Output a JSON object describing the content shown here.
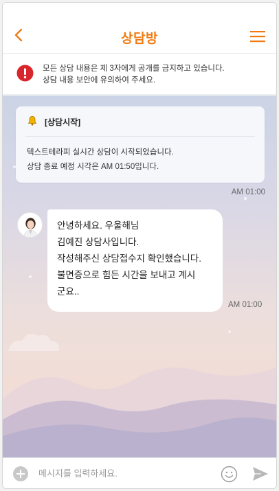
{
  "header": {
    "title": "상담방",
    "back_icon": "chevron-left-icon",
    "menu_icon": "hamburger-menu-icon"
  },
  "notice": {
    "icon": "alert-icon",
    "line1": "모든 상담 내용은 제 3자에게 공개를 금지하고 있습니다.",
    "line2": "상담 내용 보안에 유의하여 주세요."
  },
  "system_message": {
    "icon": "bell-icon",
    "title": "[상담시작]",
    "line1": "텍스트테라피 실시간 상담이 시작되었습니다.",
    "line2": "상담 종료 예정 시각은 AM 01:50입니다.",
    "time": "AM 01:00"
  },
  "counselor_message": {
    "avatar": "counselor-avatar",
    "text": "안녕하세요. 우울해님\n김예진 상담사입니다.\n작성해주신 상담접수지 확인했습니다.\n불면증으로 힘든 시간을 보내고 계시\n군요..",
    "time": "AM 01:00"
  },
  "input_bar": {
    "placeholder": "메시지를 입력하세요.",
    "value": ""
  },
  "colors": {
    "accent": "#f07b12",
    "alert": "#d9262c",
    "bell": "#f2b200"
  }
}
